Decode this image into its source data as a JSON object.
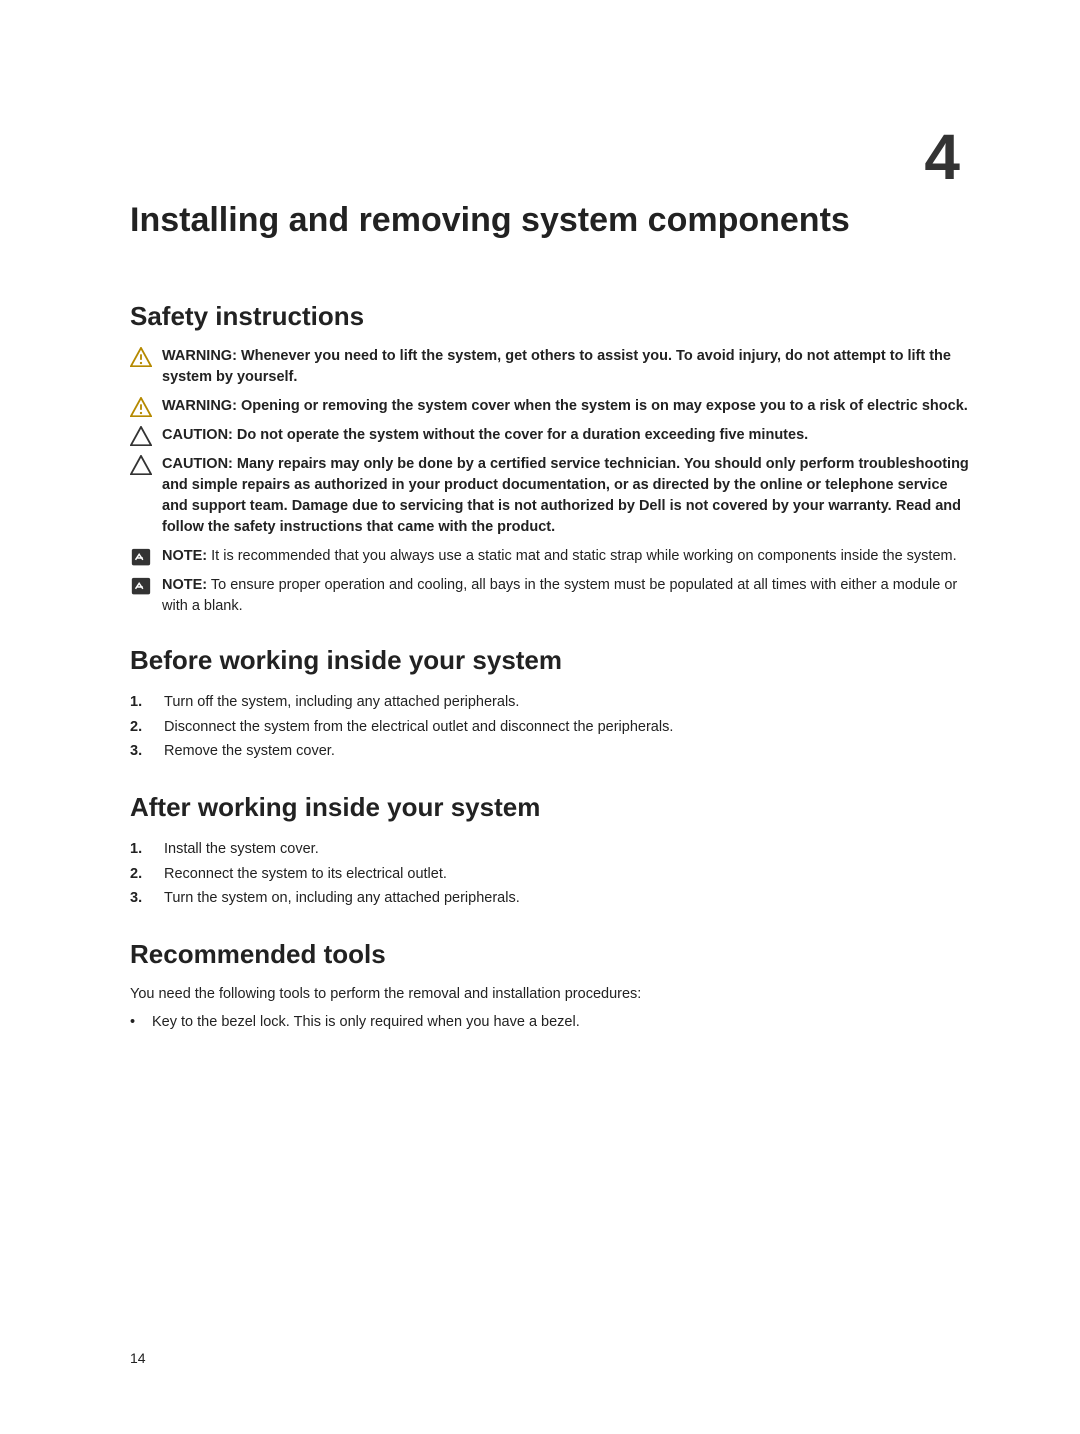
{
  "chapter_number": "4",
  "title": "Installing and removing system components",
  "page_number": "14",
  "sections": {
    "safety": {
      "heading": "Safety instructions",
      "items": [
        {
          "lead": "WARNING:",
          "text": " Whenever you need to lift the system, get others to assist you. To avoid injury, do not attempt to lift the system by yourself."
        },
        {
          "lead": "WARNING:",
          "text": " Opening or removing the system cover when the system is on may expose you to a risk of electric shock."
        },
        {
          "lead": "CAUTION:",
          "text": " Do not operate the system without the cover for a duration exceeding five minutes."
        },
        {
          "lead": "CAUTION:",
          "text": " Many repairs may only be done by a certified service technician. You should only perform troubleshooting and simple repairs as authorized in your product documentation, or as directed by the online or telephone service and support team. Damage due to servicing that is not authorized by Dell is not covered by your warranty. Read and follow the safety instructions that came with the product."
        },
        {
          "lead": "NOTE:",
          "text": " It is recommended that you always use a static mat and static strap while working on components inside the system."
        },
        {
          "lead": "NOTE:",
          "text": " To ensure proper operation and cooling, all bays in the system must be populated at all times with either a module or with a blank."
        }
      ]
    },
    "before": {
      "heading": "Before working inside your system",
      "steps": [
        "Turn off the system, including any attached peripherals.",
        "Disconnect the system from the electrical outlet and disconnect the peripherals.",
        "Remove the system cover."
      ]
    },
    "after": {
      "heading": "After working inside your system",
      "steps": [
        "Install the system cover.",
        "Reconnect the system to its electrical outlet.",
        "Turn the system on, including any attached peripherals."
      ]
    },
    "tools": {
      "heading": "Recommended tools",
      "intro": "You need the following tools to perform the removal and installation procedures:",
      "bullets": [
        "Key to the bezel lock. This is only required when you have a bezel."
      ]
    }
  }
}
